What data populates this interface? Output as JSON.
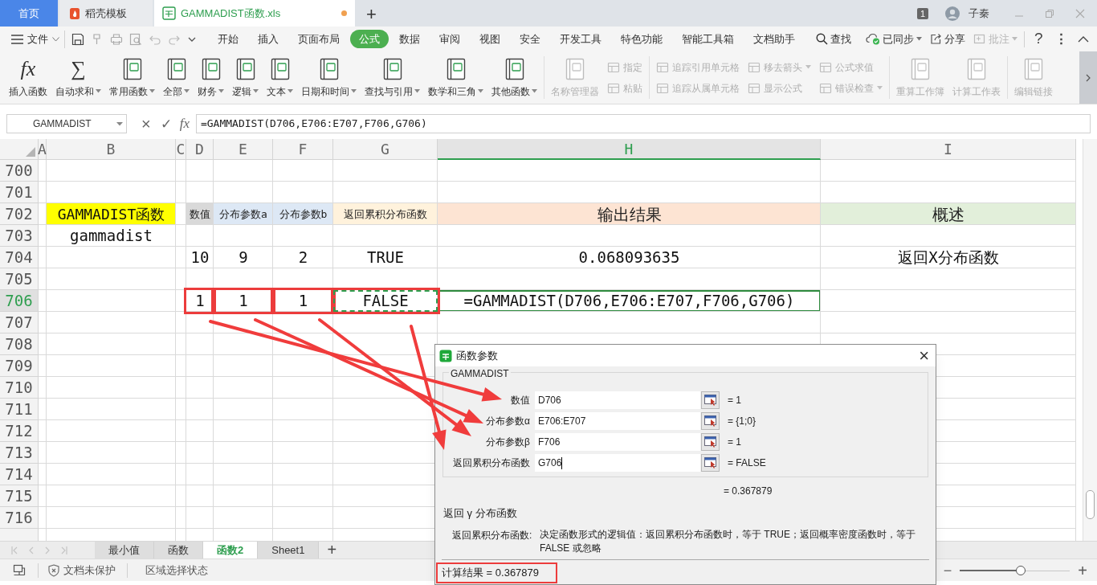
{
  "app_tabs": [
    {
      "label": "首页",
      "kind": "home",
      "selected": false,
      "unsaved": false
    },
    {
      "label": "稻壳模板",
      "kind": "template",
      "selected": false,
      "unsaved": false
    },
    {
      "label": "GAMMADIST函数.xls",
      "kind": "sheet",
      "selected": true,
      "unsaved": true
    }
  ],
  "new_tab": "+",
  "account": {
    "badge": "1",
    "user": "子秦"
  },
  "menu": {
    "file": "文件",
    "tabs": [
      {
        "label": "开始",
        "selected": false
      },
      {
        "label": "插入",
        "selected": false
      },
      {
        "label": "页面布局",
        "selected": false
      },
      {
        "label": "公式",
        "selected": true
      },
      {
        "label": "数据",
        "selected": false
      },
      {
        "label": "审阅",
        "selected": false
      },
      {
        "label": "视图",
        "selected": false
      },
      {
        "label": "安全",
        "selected": false
      },
      {
        "label": "开发工具",
        "selected": false
      },
      {
        "label": "特色功能",
        "selected": false
      },
      {
        "label": "智能工具箱",
        "selected": false
      },
      {
        "label": "文档助手",
        "selected": false
      }
    ],
    "search": "查找",
    "sync": "已同步",
    "share": "分享",
    "comment": {
      "label": "批注",
      "disabled": true
    },
    "help": "?",
    "more": "⋮"
  },
  "ribbon": {
    "groups": [
      [
        {
          "label": "插入函数",
          "kind": "large",
          "glyph": "fx",
          "dropdown": false,
          "disabled": false
        },
        {
          "label": "自动求和",
          "kind": "large",
          "glyph": "∑",
          "dropdown": true,
          "disabled": false
        },
        {
          "label": "常用函数",
          "kind": "large",
          "dropdown": true,
          "disabled": false
        },
        {
          "label": "全部",
          "kind": "large",
          "dropdown": true,
          "disabled": false
        },
        {
          "label": "财务",
          "kind": "large",
          "dropdown": true,
          "disabled": false
        },
        {
          "label": "逻辑",
          "kind": "large",
          "dropdown": true,
          "disabled": false
        },
        {
          "label": "文本",
          "kind": "large",
          "dropdown": true,
          "disabled": false
        },
        {
          "label": "日期和时间",
          "kind": "large",
          "dropdown": true,
          "disabled": false
        },
        {
          "label": "查找与引用",
          "kind": "large",
          "dropdown": true,
          "disabled": false
        },
        {
          "label": "数学和三角",
          "kind": "large",
          "dropdown": true,
          "disabled": false
        },
        {
          "label": "其他函数",
          "kind": "large",
          "dropdown": true,
          "disabled": false
        }
      ],
      [
        {
          "label": "名称管理器",
          "kind": "large",
          "dropdown": false,
          "disabled": true
        },
        {
          "label": "指定",
          "kind": "small",
          "dropdown": false,
          "disabled": true
        },
        {
          "label": "粘贴",
          "kind": "small",
          "dropdown": false,
          "disabled": true
        }
      ],
      [
        {
          "label": "追踪引用单元格",
          "kind": "small",
          "dropdown": false,
          "disabled": true
        },
        {
          "label": "追踪从属单元格",
          "kind": "small",
          "dropdown": false,
          "disabled": true
        },
        {
          "label": "移去箭头",
          "kind": "small",
          "dropdown": true,
          "disabled": true
        },
        {
          "label": "显示公式",
          "kind": "small",
          "dropdown": false,
          "disabled": true
        },
        {
          "label": "公式求值",
          "kind": "small",
          "dropdown": false,
          "disabled": true
        },
        {
          "label": "错误检查",
          "kind": "small",
          "dropdown": true,
          "disabled": true
        }
      ],
      [
        {
          "label": "重算工作簿",
          "kind": "large",
          "dropdown": false,
          "disabled": true
        },
        {
          "label": "计算工作表",
          "kind": "large",
          "dropdown": false,
          "disabled": true
        }
      ],
      [
        {
          "label": "编辑链接",
          "kind": "large",
          "dropdown": false,
          "disabled": true
        }
      ]
    ]
  },
  "formula_bar": {
    "name_box": "GAMMADIST",
    "cancel": "×",
    "enter": "✓",
    "fx": "fx",
    "formula": "=GAMMADIST(D706,E706:E707,F706,G706)"
  },
  "columns": [
    {
      "label": "A",
      "selected": false
    },
    {
      "label": "B",
      "selected": false
    },
    {
      "label": "C",
      "selected": false
    },
    {
      "label": "D",
      "selected": false
    },
    {
      "label": "E",
      "selected": false
    },
    {
      "label": "F",
      "selected": false
    },
    {
      "label": "G",
      "selected": false
    },
    {
      "label": "H",
      "selected": true
    },
    {
      "label": "I",
      "selected": false
    }
  ],
  "rows": [
    {
      "header": "700",
      "selected": false
    },
    {
      "header": "701",
      "selected": false
    },
    {
      "header": "702",
      "selected": false,
      "cells": {
        "B": {
          "text": "GAMMADIST函数",
          "color": "#ffff00",
          "selected": false,
          "outlined": false,
          "marquee": false
        },
        "D": {
          "text": "数值",
          "color": "#d9d9d9",
          "selected": false,
          "outlined": false,
          "marquee": false
        },
        "E": {
          "text": "分布参数a",
          "color": "#dde8f5",
          "selected": false,
          "outlined": false,
          "marquee": false
        },
        "F": {
          "text": "分布参数b",
          "color": "#dde8f5",
          "selected": false,
          "outlined": false,
          "marquee": false
        },
        "G": {
          "text": "返回累积分布函数",
          "color": "#fff2dc",
          "selected": false,
          "outlined": false,
          "marquee": false
        },
        "H": {
          "text": "输出结果",
          "color": "#fde4d3",
          "selected": false,
          "outlined": false,
          "marquee": false
        },
        "I": {
          "text": "概述",
          "color": "#e2efda",
          "selected": false,
          "outlined": false,
          "marquee": false
        }
      }
    },
    {
      "header": "703",
      "selected": false,
      "cells": {
        "B": {
          "text": "gammadist",
          "selected": false,
          "outlined": false,
          "marquee": false
        }
      }
    },
    {
      "header": "704",
      "selected": false,
      "cells": {
        "D": {
          "text": "10",
          "selected": false,
          "outlined": false,
          "marquee": false
        },
        "E": {
          "text": "9",
          "selected": false,
          "outlined": false,
          "marquee": false
        },
        "F": {
          "text": "2",
          "selected": false,
          "outlined": false,
          "marquee": false
        },
        "G": {
          "text": "TRUE",
          "selected": false,
          "outlined": false,
          "marquee": false
        },
        "H": {
          "text": "0.068093635",
          "selected": false,
          "outlined": false,
          "marquee": false
        },
        "I": {
          "text": "返回X分布函数",
          "selected": false,
          "outlined": false,
          "marquee": false
        }
      }
    },
    {
      "header": "705",
      "selected": false
    },
    {
      "header": "706",
      "selected": true,
      "cells": {
        "D": {
          "text": "1",
          "selected": false,
          "outlined": true,
          "marquee": false
        },
        "E": {
          "text": "1",
          "selected": false,
          "outlined": true,
          "marquee": false
        },
        "F": {
          "text": "1",
          "selected": false,
          "outlined": true,
          "marquee": false
        },
        "G": {
          "text": "FALSE",
          "selected": false,
          "outlined": true,
          "marquee": true
        },
        "H": {
          "text": "=GAMMADIST(D706,E706:E707,F706,G706)",
          "selected": true,
          "outlined": false,
          "marquee": false
        }
      }
    },
    {
      "header": "707",
      "selected": false
    },
    {
      "header": "708",
      "selected": false
    },
    {
      "header": "709",
      "selected": false
    },
    {
      "header": "710",
      "selected": false
    },
    {
      "header": "711",
      "selected": false
    },
    {
      "header": "712",
      "selected": false
    },
    {
      "header": "713",
      "selected": false
    },
    {
      "header": "714",
      "selected": false
    },
    {
      "header": "715",
      "selected": false
    },
    {
      "header": "716",
      "selected": false
    }
  ],
  "sheet_tabs": [
    {
      "label": "最小值",
      "selected": false
    },
    {
      "label": "函数",
      "selected": false
    },
    {
      "label": "函数2",
      "selected": true
    },
    {
      "label": "Sheet1",
      "selected": false
    }
  ],
  "add_sheet": "+",
  "status_bar": {
    "protection": "文档未保护",
    "mode": "区域选择状态",
    "zoom": {
      "minus": "−",
      "plus": "+",
      "level": 0.55
    }
  },
  "dialog": {
    "title": "函数参数",
    "close": "×",
    "function": "GAMMADIST",
    "params": [
      {
        "label": "数值",
        "value": "D706",
        "result": "= 1",
        "focused": false
      },
      {
        "label": "分布参数α",
        "value": "E706:E707",
        "result": "= {1;0}",
        "focused": false
      },
      {
        "label": "分布参数β",
        "value": "F706",
        "result": "= 1",
        "focused": false
      },
      {
        "label": "返回累积分布函数",
        "value": "G706",
        "result": "= FALSE",
        "focused": true
      }
    ],
    "result": "= 0.367879",
    "summary": "返回 γ 分布函数",
    "help_label": "返回累积分布函数:",
    "help_text": "决定函数形式的逻辑值：返回累积分布函数时，等于 TRUE；返回概率密度函数时，等于 FALSE 或忽略",
    "footer": {
      "text": "计算结果 = 0.367879",
      "outlined": true
    }
  }
}
